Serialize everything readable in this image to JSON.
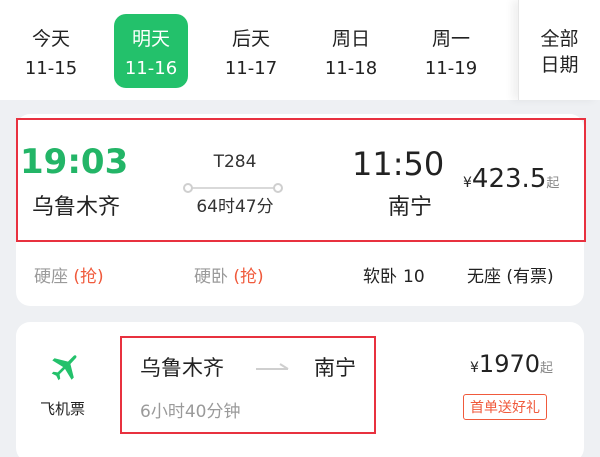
{
  "date_bar": {
    "dates": [
      {
        "name": "今天",
        "date": "11-15",
        "active": false
      },
      {
        "name": "明天",
        "date": "11-16",
        "active": true
      },
      {
        "name": "后天",
        "date": "11-17",
        "active": false
      },
      {
        "name": "周日",
        "date": "11-18",
        "active": false
      },
      {
        "name": "周一",
        "date": "11-19",
        "active": false
      }
    ],
    "all_dates_line1": "全部",
    "all_dates_line2": "日期"
  },
  "train": {
    "departure_time": "19:03",
    "departure_station": "乌鲁木齐",
    "train_number": "T284",
    "duration": "64时47分",
    "arrival_time": "11:50",
    "arrival_station": "南宁",
    "price_currency": "¥",
    "price": "423.5",
    "price_suffix": "起",
    "seats": [
      {
        "name": "硬座",
        "status": "(抢)",
        "available": false
      },
      {
        "name": "硬卧",
        "status": "(抢)",
        "available": false
      },
      {
        "name": "软卧",
        "status": "10",
        "available": true
      },
      {
        "name": "无座",
        "status": "(有票)",
        "available": true
      }
    ]
  },
  "flight": {
    "icon": "airplane-icon",
    "label": "飞机票",
    "from": "乌鲁木齐",
    "to": "南宁",
    "duration": "6小时40分钟",
    "price_currency": "¥",
    "price": "1970",
    "price_suffix": "起",
    "promo": "首单送好礼"
  },
  "colors": {
    "accent_green": "#23c16b",
    "highlight_red": "#e8313f",
    "tag_orange": "#f05a3c"
  }
}
